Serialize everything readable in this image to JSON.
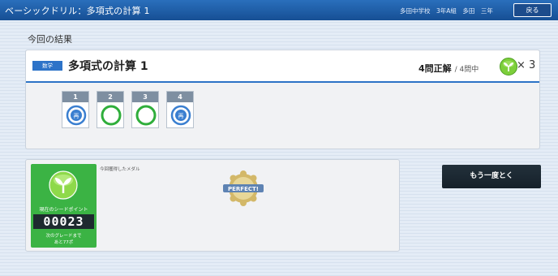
{
  "header": {
    "title": "ベーシックドリル：多項式の計算 1",
    "user_info": "多田中学校　3年A組　多田　三年",
    "back_label": "戻る"
  },
  "section_title": "今回の結果",
  "result": {
    "badge": "数学",
    "drill_name": "多項式の計算 1",
    "correct": "4問正解",
    "total": "/ 4問中",
    "seed_multiplier": "× 3",
    "questions": [
      {
        "num": "1",
        "mark": "retry"
      },
      {
        "num": "2",
        "mark": "correct"
      },
      {
        "num": "3",
        "mark": "correct"
      },
      {
        "num": "4",
        "mark": "retry"
      }
    ],
    "retry_mark_symbol": "再"
  },
  "seed_panel": {
    "label": "現在のシードポイント",
    "points": "00023",
    "next_line1": "次のグレードまで",
    "next_line2": "あと77ポ",
    "medal_label": "今回獲得したメダル",
    "medal_text": "PERFECT!",
    "accent_color": "#3bb344"
  },
  "retry_button": "もう一度とく",
  "colors": {
    "header": "#1b5ba6",
    "accent_blue": "#2c73c6",
    "correct_green": "#2fae3b"
  }
}
